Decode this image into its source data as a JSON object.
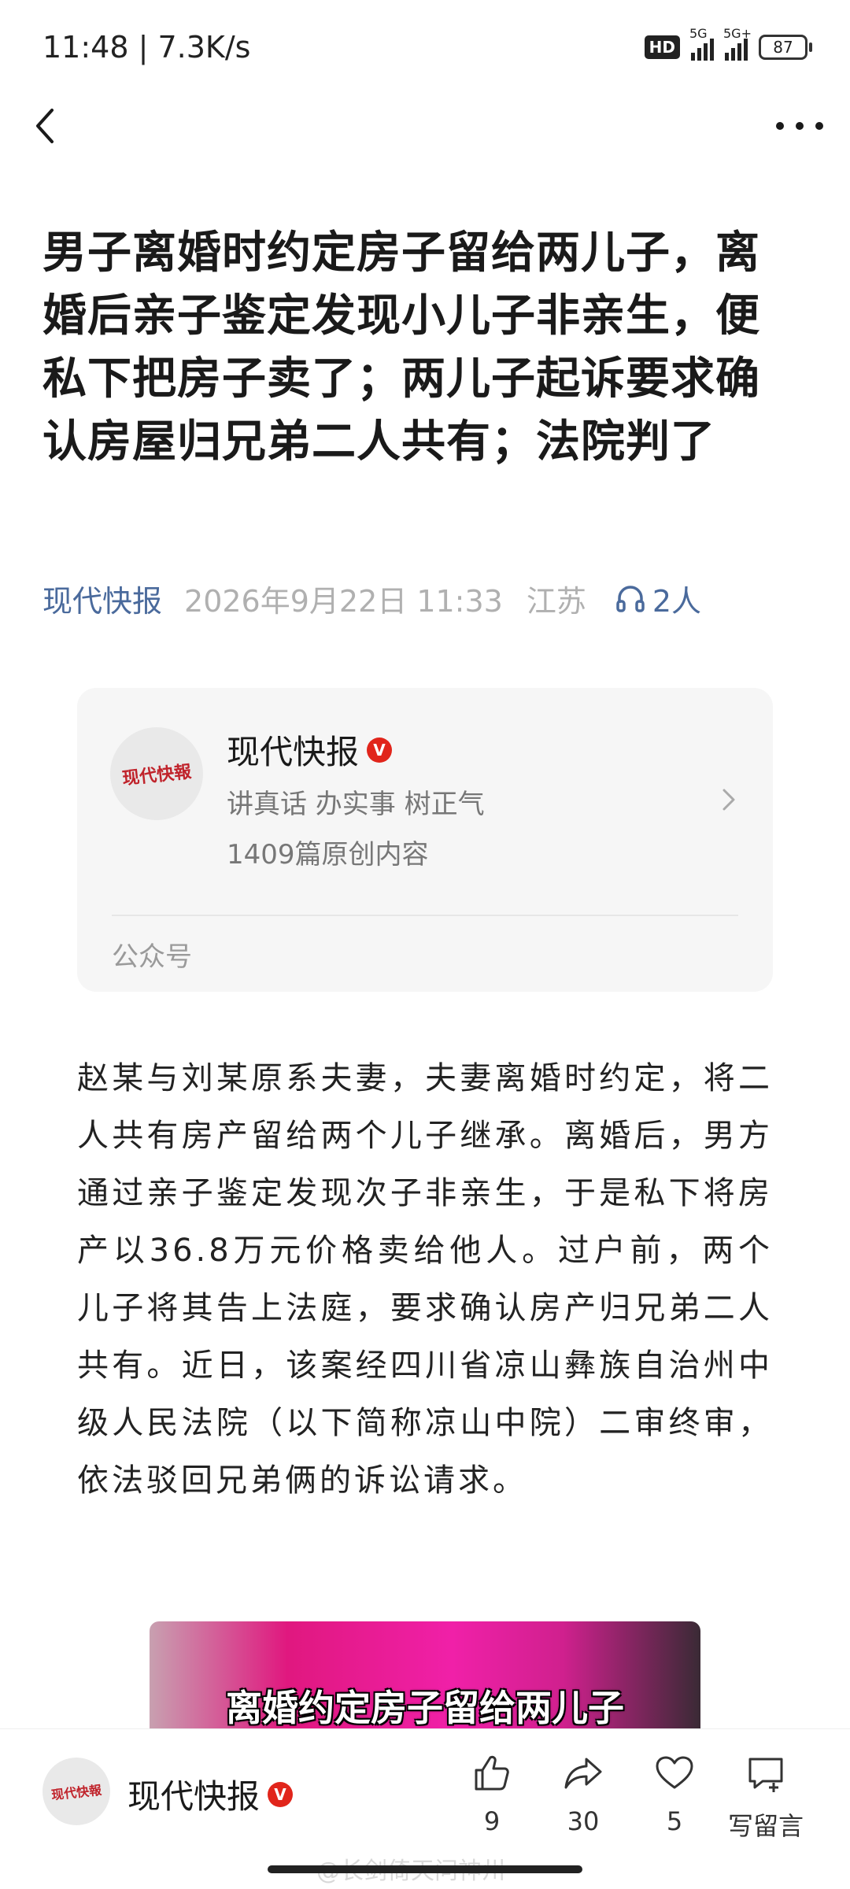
{
  "status_bar": {
    "time": "11:48 | 7.3K/s",
    "hd_label": "HD",
    "network_1": "5G",
    "network_2": "5G+",
    "battery": "87"
  },
  "article": {
    "title": "男子离婚时约定房子留给两儿子，离婚后亲子鉴定发现小儿子非亲生，便私下把房子卖了；两儿子起诉要求确认房屋归兄弟二人共有；法院判了",
    "source": "现代快报",
    "date": "2026年9月22日 11:33",
    "region": "江苏",
    "listeners": "2人",
    "body": "赵某与刘某原系夫妻，夫妻离婚时约定，将二人共有房产留给两个儿子继承。离婚后，男方通过亲子鉴定发现次子非亲生，于是私下将房产以36.8万元价格卖给他人。过户前，两个儿子将其告上法庭，要求确认房产归兄弟二人共有。近日，该案经四川省凉山彝族自治州中级人民法院（以下简称凉山中院）二审终审，依法驳回兄弟俩的诉讼请求。",
    "video_caption": "离婚约定房子留给两儿子"
  },
  "account_card": {
    "avatar_text": "现代快報",
    "name": "现代快报",
    "verified": "V",
    "slogan": "讲真话 办实事 树正气",
    "original_count": "1409篇原创内容",
    "type": "公众号"
  },
  "bottom_bar": {
    "avatar_text": "现代快報",
    "name": "现代快报",
    "verified": "V",
    "like_count": "9",
    "share_count": "30",
    "favorite_count": "5",
    "comment_label": "写留言"
  },
  "watermark": "@长剑倚天问神州",
  "colors": {
    "source_blue": "#4a6a9c",
    "verified_red": "#e1251b"
  }
}
